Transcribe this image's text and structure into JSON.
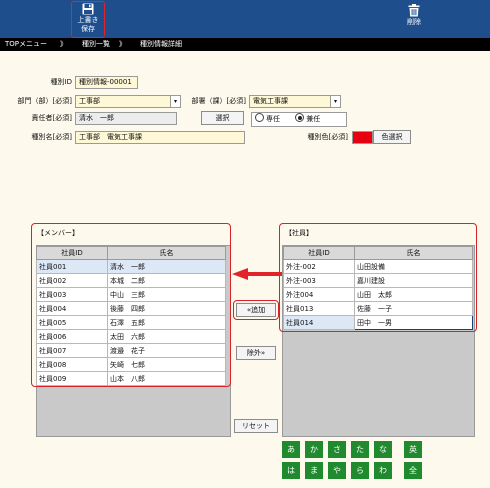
{
  "toolbar": {
    "save_label_1": "上書き",
    "save_label_2": "保存",
    "delete_label": "削除"
  },
  "nav": {
    "top": "TOPメニュー",
    "sep": "》",
    "list": "種別一覧",
    "detail": "種別情報詳細"
  },
  "form": {
    "type_id_label": "種別ID",
    "type_id_value": "種別情報-00001",
    "dept_label": "部門（部）[必須]",
    "dept_value": "工事部",
    "section_label": "部署（課）[必須]",
    "section_value": "電気工事課",
    "manager_label": "責任者[必須]",
    "manager_value": "清水　一郎",
    "select_button": "選択",
    "radio_full": "専任",
    "radio_part": "兼任",
    "type_name_label": "種別名[必須]",
    "type_name_value": "工事部　電気工事課",
    "type_color_label": "種別色[必須]",
    "type_color": "#e60012",
    "color_select_button": "色選択"
  },
  "members": {
    "title": "【メンバー】",
    "col_id": "社員ID",
    "col_name": "氏名",
    "rows": [
      {
        "id": "社員001",
        "name": "清水　一郎"
      },
      {
        "id": "社員002",
        "name": "本城　二郎"
      },
      {
        "id": "社員003",
        "name": "中山　三郎"
      },
      {
        "id": "社員004",
        "name": "後藤　四郎"
      },
      {
        "id": "社員005",
        "name": "石澤　五郎"
      },
      {
        "id": "社員006",
        "name": "太田　六郎"
      },
      {
        "id": "社員007",
        "name": "渡邉　花子"
      },
      {
        "id": "社員008",
        "name": "矢崎　七郎"
      },
      {
        "id": "社員009",
        "name": "山本　八郎"
      }
    ]
  },
  "employees": {
    "title": "【社員】",
    "col_id": "社員ID",
    "col_name": "氏名",
    "rows": [
      {
        "id": "外注-002",
        "name": "山田設備"
      },
      {
        "id": "外注-003",
        "name": "嘉川建設"
      },
      {
        "id": "外注004",
        "name": "山田　太郎"
      },
      {
        "id": "社員013",
        "name": "佐藤　一子"
      },
      {
        "id": "社員014",
        "name": "田中　一男"
      }
    ]
  },
  "actions": {
    "add": "«追加",
    "remove": "除外»",
    "reset": "リセット"
  },
  "kana": {
    "row1": [
      "あ",
      "か",
      "さ",
      "た",
      "な"
    ],
    "row2": [
      "は",
      "ま",
      "や",
      "ら",
      "わ"
    ],
    "alpha": "英",
    "all": "全"
  },
  "colors": {
    "toolbar": "#1f4e8c",
    "highlight": "#d8222a",
    "kana_button": "#1f8a2e"
  }
}
